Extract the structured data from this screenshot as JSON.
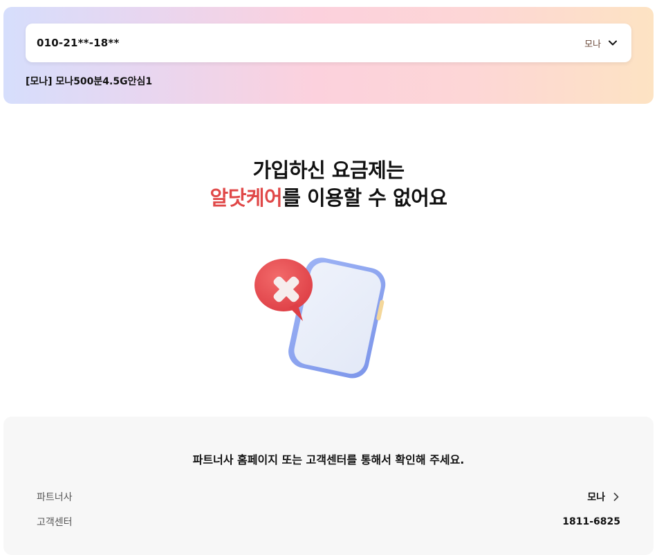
{
  "line_selector": {
    "phone_number": "010-21**-18**",
    "carrier": "모나",
    "icon": "chevron-down-icon"
  },
  "plan": {
    "name": "[모나] 모나500분4.5G안심1"
  },
  "headline": {
    "line1": "가입하신 요금제는",
    "service_name": "알닷케어",
    "line2_rest": "를 이용할 수 없어요",
    "accent_color": "#e04848"
  },
  "illustration": {
    "icon": "phone-error-icon",
    "badge_icon": "x-mark-icon"
  },
  "guide": {
    "text": "파트너사 홈페이지 또는 고객센터를 통해서 확인해 주세요.",
    "rows": [
      {
        "label": "파트너사",
        "value": "모나",
        "icon": "chevron-right-icon"
      },
      {
        "label": "고객센터",
        "value": "1811-6825"
      }
    ]
  }
}
